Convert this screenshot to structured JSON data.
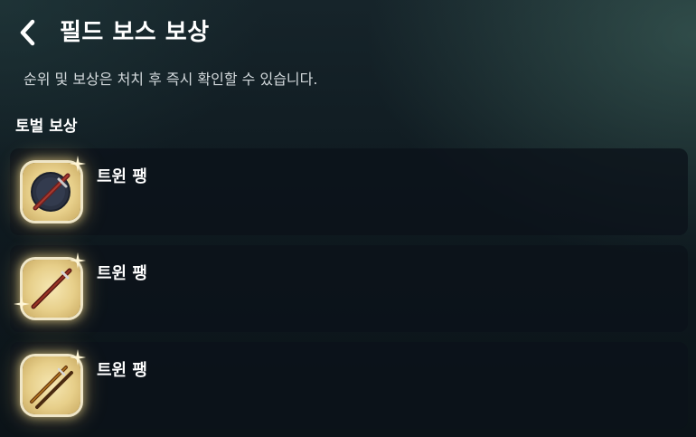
{
  "header": {
    "title": "필드 보스 보상",
    "back_icon": "chevron-left-icon"
  },
  "description": "순위 및 보상은 처치 후 즉시 확인할 수 있습니다.",
  "section": {
    "title": "토벌 보상"
  },
  "rewards": [
    {
      "name": "트윈 팽",
      "icon": "twin-fang-shield-sword-icon"
    },
    {
      "name": "트윈 팽",
      "icon": "twin-fang-sword-icon"
    },
    {
      "name": "트윈 팽",
      "icon": "twin-fang-dual-blades-icon"
    }
  ],
  "colors": {
    "background_top": "#16242a",
    "background_bottom": "#0b1318",
    "card": "#0c121a",
    "icon_gold": "#e7cf8a",
    "text": "#ffffff",
    "subtext": "#d3d9dc"
  }
}
